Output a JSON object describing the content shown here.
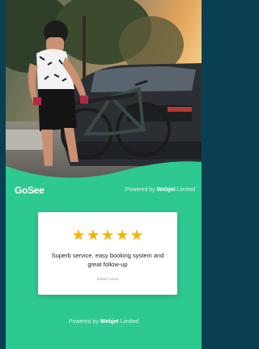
{
  "brand": {
    "logo_text": "GoSee",
    "powered_prefix": "Powered by",
    "powered_brand": "Webjet",
    "powered_suffix": "Limited"
  },
  "review": {
    "rating": 5,
    "rating_max": 5,
    "text": "Superb service, easy booking system and great follow-up",
    "author": "Robert Jones"
  },
  "footer": {
    "powered_prefix": "Powered by",
    "powered_brand": "Webjet",
    "powered_suffix": "Limited"
  },
  "colors": {
    "page_background": "#0a3f52",
    "accent_green": "#2ec891",
    "star": "#f5b301"
  },
  "hero": {
    "image": "cyclist-mounting-bike-on-car-rack-photo"
  }
}
